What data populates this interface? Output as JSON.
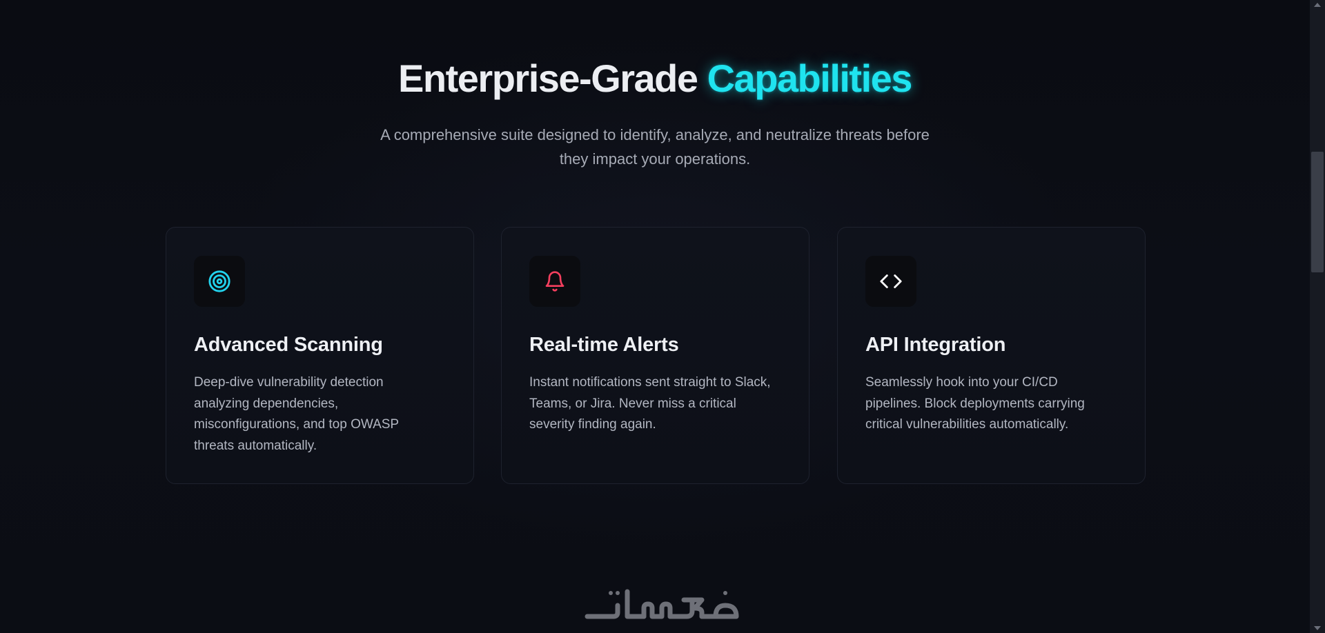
{
  "header": {
    "title_main": "Enterprise-Grade",
    "title_accent": "Capabilities",
    "subtitle_line1": "A comprehensive suite designed to identify, analyze, and neutralize threats before",
    "subtitle_line2": "they impact your operations."
  },
  "features": [
    {
      "icon": "target-icon",
      "icon_color": "#22d3ee",
      "title": "Advanced Scanning",
      "description": "Deep-dive vulnerability detection analyzing dependencies, misconfigurations, and top OWASP threats automatically."
    },
    {
      "icon": "bell-icon",
      "icon_color": "#f43f5e",
      "title": "Real-time Alerts",
      "description": "Instant notifications sent straight to Slack, Teams, or Jira. Never miss a critical severity finding again."
    },
    {
      "icon": "code-icon",
      "icon_color": "#ffffff",
      "title": "API Integration",
      "description": "Seamlessly hook into your CI/CD pipelines. Block deployments carrying critical vulnerabilities automatically."
    }
  ],
  "watermark": {
    "text": "خمسات"
  },
  "colors": {
    "accent": "#1fe3ef",
    "background": "#0b0d14",
    "card_border": "#1e222e"
  }
}
